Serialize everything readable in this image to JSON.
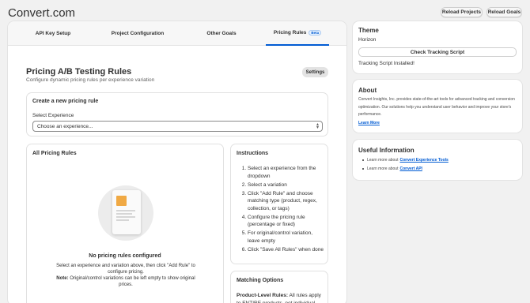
{
  "app": {
    "title": "Convert.com"
  },
  "header": {
    "reload_projects": "Reload Projects",
    "reload_goals": "Reload Goals"
  },
  "tabs": [
    {
      "label": "API Key Setup"
    },
    {
      "label": "Project Configuration"
    },
    {
      "label": "Other Goals"
    },
    {
      "label": "Pricing Rules",
      "badge": "Beta",
      "active": true
    }
  ],
  "page": {
    "title": "Pricing A/B Testing Rules",
    "subtitle": "Configure dynamic pricing rules per experience variation",
    "settings_label": "Settings"
  },
  "create_card": {
    "title": "Create a new pricing rule",
    "select_label": "Select Experience",
    "select_value": "Choose an experience..."
  },
  "rules_card": {
    "title": "All Pricing Rules",
    "empty_title": "No pricing rules configured",
    "empty_desc": "Select an experience and variation above, then click \"Add Rule\" to configure pricing.",
    "note_label": "Note:",
    "note_text": "Original/control variations can be left empty to show original prices."
  },
  "instructions": {
    "title": "Instructions",
    "steps": [
      "Select an experience from the dropdown",
      "Select a variation",
      "Click \"Add Rule\" and choose matching type (product, regex, collection, or tags)",
      "Configure the pricing rule (percentage or fixed)",
      "For original/control variation, leave empty",
      "Click \"Save All Rules\" when done"
    ]
  },
  "matching": {
    "title": "Matching Options",
    "bold_label": "Product-Level Rules:",
    "text": "All rules apply to ENTIRE products, not individual"
  },
  "theme": {
    "title": "Theme",
    "name": "Horizon",
    "check_button": "Check Tracking Script",
    "status": "Tracking Script Installed!"
  },
  "about": {
    "title": "About",
    "text": "Convert Insights, Inc. provides state-of-the-art tools for advanced tracking and conversion optimization. Our solutions help you understand user behavior and improve your store's performance.",
    "link": "Learn More"
  },
  "useful_info": {
    "title": "Useful Information",
    "items": [
      {
        "prefix": "Learn more about",
        "link": "Convert Experience Tools"
      },
      {
        "prefix": "Learn more about",
        "link": "Convert API"
      }
    ]
  }
}
